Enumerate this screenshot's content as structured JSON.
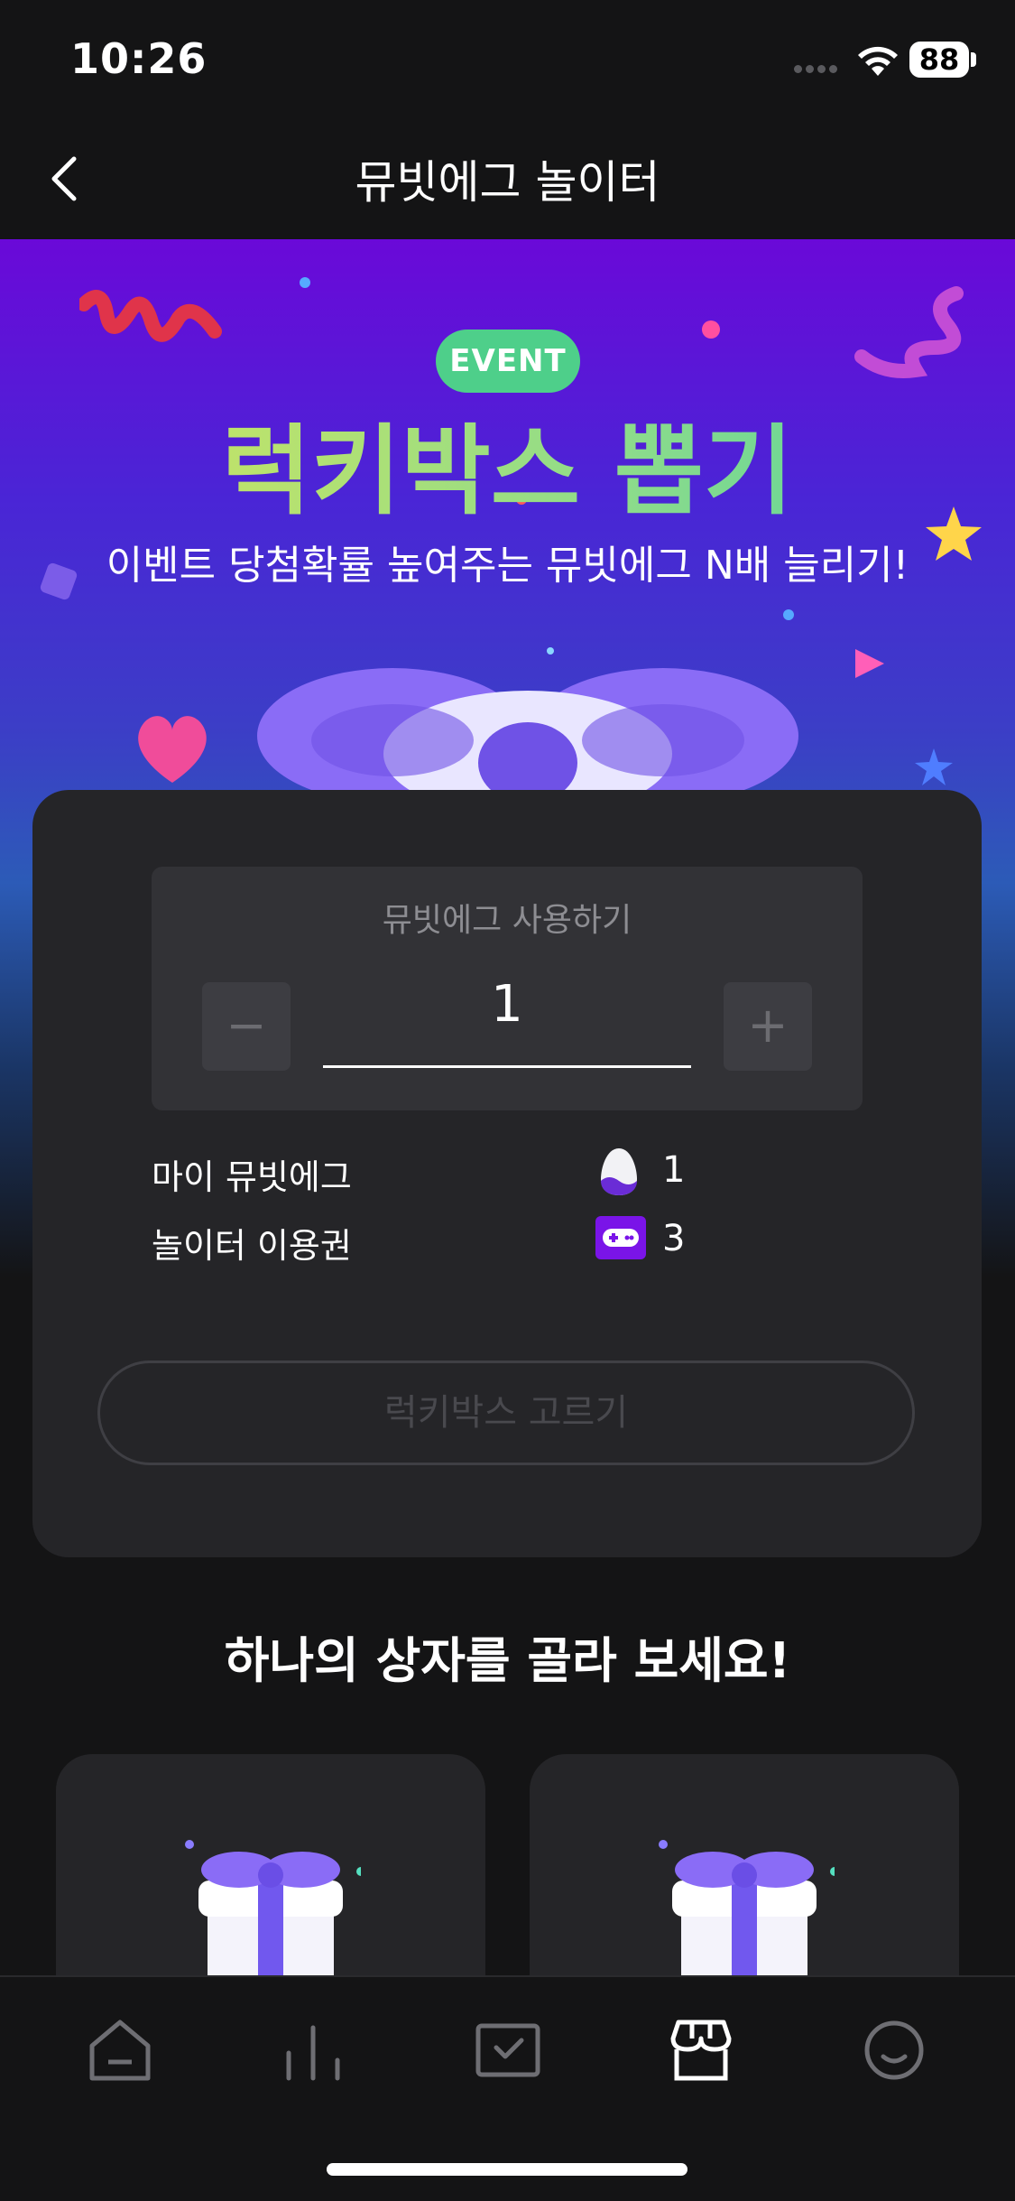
{
  "status_bar": {
    "time": "10:26",
    "battery": "88"
  },
  "nav": {
    "title": "뮤빗에그 놀이터"
  },
  "hero": {
    "badge": "EVENT",
    "title": "럭키박스 뽑기",
    "subtitle": "이벤트 당첨확률 높여주는 뮤빗에그 N배 늘리기!"
  },
  "use_panel": {
    "label": "뮤빗에그 사용하기",
    "decrement": "−",
    "increment": "+",
    "quantity": "1"
  },
  "balances": [
    {
      "label": "마이 뮤빗에그",
      "icon": "egg-icon",
      "value": "1"
    },
    {
      "label": "놀이터 이용권",
      "icon": "game-ticket-icon",
      "value": "3"
    }
  ],
  "pick_button": "럭키박스 고르기",
  "section_title": "하나의 상자를 골라 보세요!",
  "tabs": [
    {
      "icon": "home-icon"
    },
    {
      "icon": "chart-icon"
    },
    {
      "icon": "inbox-check-icon"
    },
    {
      "icon": "store-icon",
      "active": true
    },
    {
      "icon": "smile-icon"
    }
  ],
  "colors": {
    "accent_green": "#4ecf8a",
    "title_green": "#a9e07b",
    "purple": "#6a09d8",
    "card": "#252528",
    "background": "#141415"
  }
}
